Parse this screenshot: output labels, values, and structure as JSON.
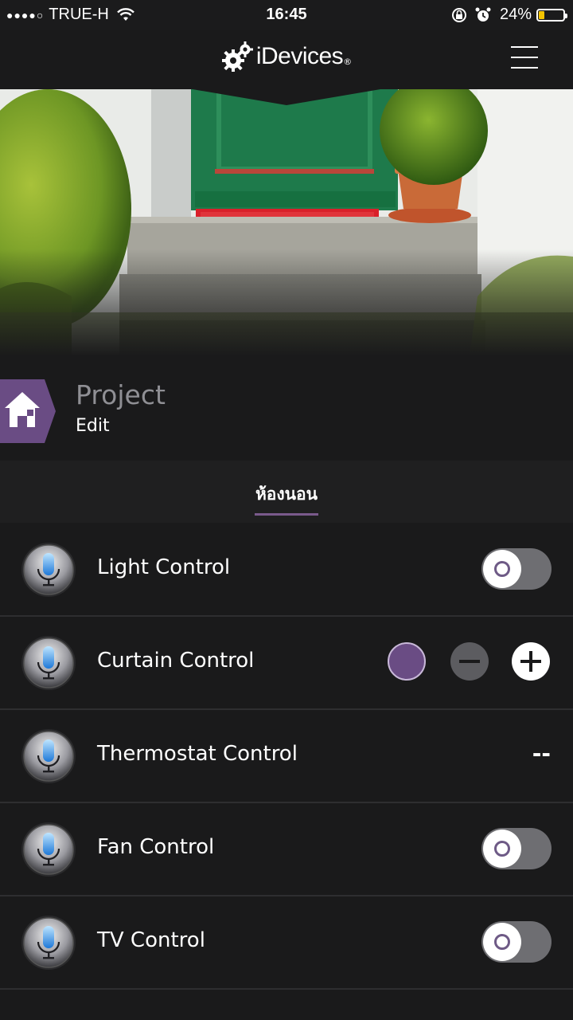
{
  "status_bar": {
    "signal_dots": "●●●●○",
    "carrier": "TRUE-H",
    "time": "16:45",
    "battery_percent": "24%",
    "battery_level": 0.24,
    "battery_color": "#f5c400"
  },
  "header": {
    "brand": "iDevices",
    "brand_mark": "®",
    "menu_icon": "hamburger-icon"
  },
  "project": {
    "title": "Project",
    "edit_label": "Edit",
    "accent": "#6a4c84"
  },
  "tabs": [
    {
      "label": "ห้องนอน",
      "active": true
    }
  ],
  "controls": [
    {
      "label": "Light Control",
      "kind": "toggle",
      "on": false
    },
    {
      "label": "Curtain Control",
      "kind": "stepper"
    },
    {
      "label": "Thermostat Control",
      "kind": "value",
      "value": "--"
    },
    {
      "label": "Fan Control",
      "kind": "toggle",
      "on": false
    },
    {
      "label": "TV Control",
      "kind": "toggle",
      "on": false
    }
  ]
}
